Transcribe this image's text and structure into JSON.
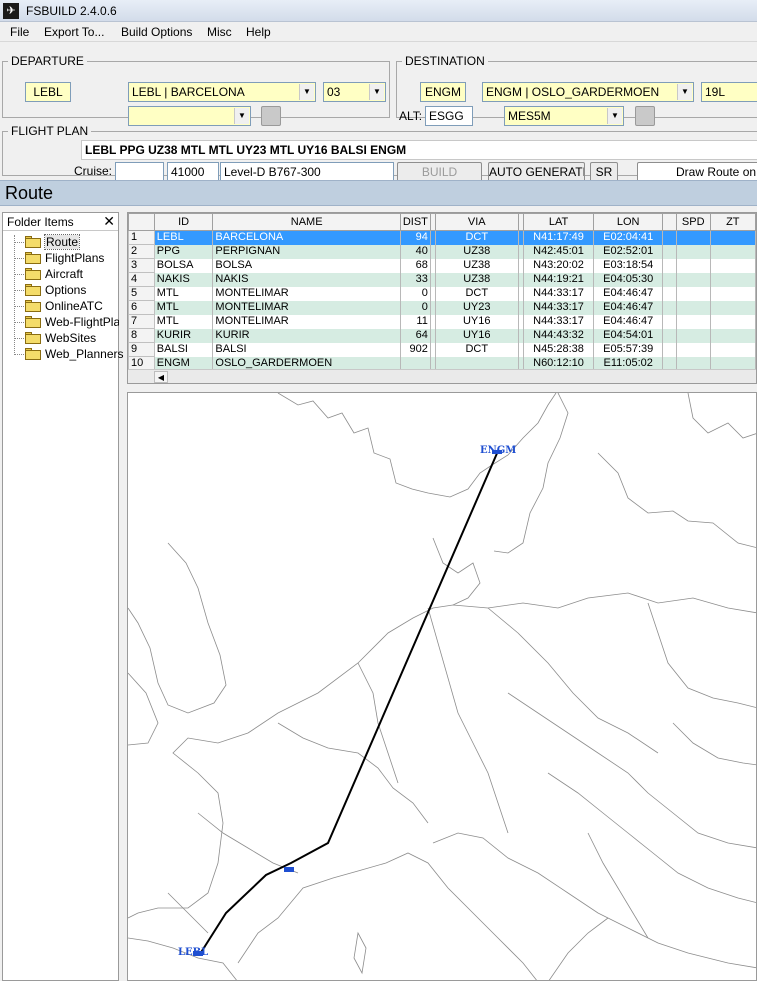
{
  "window": {
    "title": "FSBUILD 2.4.0.6"
  },
  "menu": [
    "File",
    "Export To...",
    "Build Options",
    "Misc",
    "Help"
  ],
  "departure": {
    "legend": "DEPARTURE",
    "icao": "LEBL",
    "airport": "LEBL | BARCELONA",
    "runway": "03",
    "sid": ""
  },
  "destination": {
    "legend": "DESTINATION",
    "icao": "ENGM",
    "airport": "ENGM | OSLO_GARDERMOEN",
    "runway": "19L",
    "alt_label": "ALT:",
    "alt_icao": "ESGG",
    "star": "MES5M"
  },
  "flight_plan": {
    "legend": "FLIGHT PLAN",
    "route": "LEBL PPG UZ38 MTL MTL UY23 MTL UY16 BALSI ENGM",
    "cruise_label": "Cruise:",
    "cruise_speed": "",
    "cruise_alt": "41000",
    "aircraft": "Level-D B767-300",
    "build_label": "BUILD",
    "auto_generate_label": "AUTO GENERATE",
    "sr_label": "SR",
    "draw_route_label": "Draw Route on M"
  },
  "route_section": {
    "title": "Route"
  },
  "folder_panel": {
    "title": "Folder Items",
    "close": "✕",
    "items": [
      "Route",
      "FlightPlans",
      "Aircraft",
      "Options",
      "OnlineATC",
      "Web-FlightPlans",
      "WebSites",
      "Web_Planners"
    ]
  },
  "table": {
    "columns": [
      "ID",
      "NAME",
      "DIST",
      "VIA",
      "LAT",
      "LON",
      "SPD",
      "ZT"
    ],
    "rows": [
      [
        "1",
        "LEBL",
        "BARCELONA",
        "94",
        "DCT",
        "N41:17:49",
        "E02:04:41",
        "",
        ""
      ],
      [
        "2",
        "PPG",
        "PERPIGNAN",
        "40",
        "UZ38",
        "N42:45:01",
        "E02:52:01",
        "",
        ""
      ],
      [
        "3",
        "BOLSA",
        "BOLSA",
        "68",
        "UZ38",
        "N43:20:02",
        "E03:18:54",
        "",
        ""
      ],
      [
        "4",
        "NAKIS",
        "NAKIS",
        "33",
        "UZ38",
        "N44:19:21",
        "E04:05:30",
        "",
        ""
      ],
      [
        "5",
        "MTL",
        "MONTELIMAR",
        "0",
        "DCT",
        "N44:33:17",
        "E04:46:47",
        "",
        ""
      ],
      [
        "6",
        "MTL",
        "MONTELIMAR",
        "0",
        "UY23",
        "N44:33:17",
        "E04:46:47",
        "",
        ""
      ],
      [
        "7",
        "MTL",
        "MONTELIMAR",
        "11",
        "UY16",
        "N44:33:17",
        "E04:46:47",
        "",
        ""
      ],
      [
        "8",
        "KURIR",
        "KURIR",
        "64",
        "UY16",
        "N44:43:32",
        "E04:54:01",
        "",
        ""
      ],
      [
        "9",
        "BALSI",
        "BALSI",
        "902",
        "DCT",
        "N45:28:38",
        "E05:57:39",
        "",
        ""
      ],
      [
        "10",
        "ENGM",
        "OSLO_GARDERMOEN",
        "",
        "",
        "N60:12:10",
        "E11:05:02",
        "",
        ""
      ]
    ]
  },
  "map": {
    "departure_label": "LEBL",
    "destination_label": "ENGM",
    "route_color": "#000000",
    "marker_color": "#1f4fd1",
    "coast_color": "#8c8c8c"
  }
}
